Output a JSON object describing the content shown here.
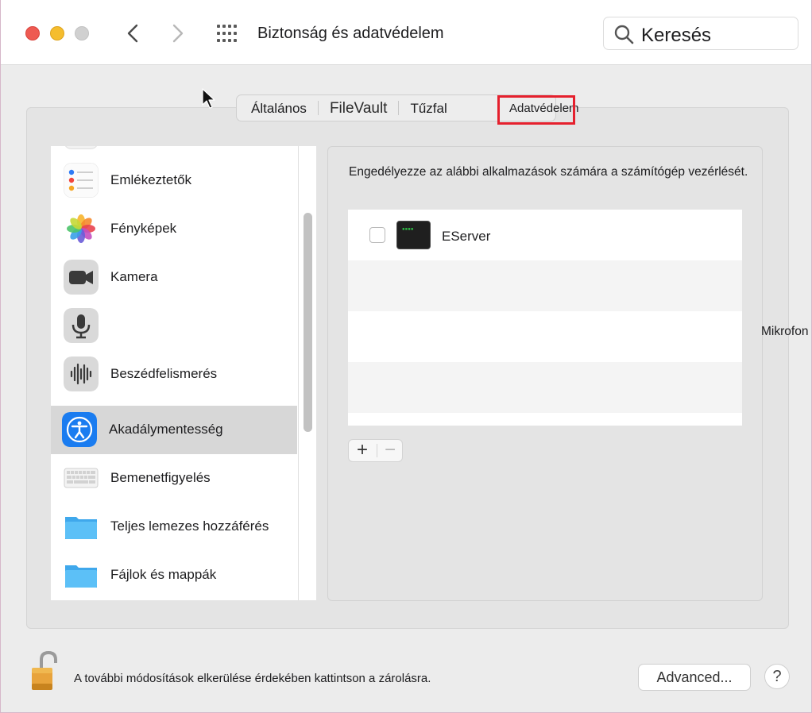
{
  "window": {
    "title": "Biztonság és adatvédelem",
    "search_placeholder": "Keresés"
  },
  "tabs": [
    {
      "label": "Általános"
    },
    {
      "label": "FileVault"
    },
    {
      "label": "Tűzfal"
    },
    {
      "label": "Adatvédelem",
      "selected": true
    }
  ],
  "sidebar": {
    "items": [
      {
        "label": "Emlékeztetők",
        "icon": "reminders-icon"
      },
      {
        "label": "Fényképek",
        "icon": "photos-icon"
      },
      {
        "label": "Kamera",
        "icon": "camera-icon"
      },
      {
        "label": "",
        "icon": "microphone-icon"
      },
      {
        "label": "Beszédfelismerés",
        "icon": "speech-recognition-icon"
      },
      {
        "label": "Akadálymentesség",
        "icon": "accessibility-icon",
        "selected": true
      },
      {
        "label": "Bemenetfigyelés",
        "icon": "keyboard-icon"
      },
      {
        "label": "Teljes lemezes hozzáférés",
        "icon": "folder-icon"
      },
      {
        "label": "Fájlok és mappák",
        "icon": "folder-icon"
      }
    ]
  },
  "detail": {
    "description": "Engedélyezze az alábbi alkalmazások számára a számítógép vezérlését.",
    "apps": [
      {
        "name": "EServer",
        "checked": false,
        "icon": "terminal-icon"
      }
    ],
    "add_label": "+",
    "remove_label": "−"
  },
  "floating_label": "Mikrofon",
  "footer": {
    "lock_text": "A további módosítások elkerülése érdekében kattintson a zárolásra.",
    "advanced_label": "Advanced...",
    "help_label": "?"
  },
  "colors": {
    "close": "#ee5a52",
    "minimize": "#f5bd2e",
    "highlight_box": "#e5202d",
    "accessibility_blue": "#1a7cf0"
  }
}
